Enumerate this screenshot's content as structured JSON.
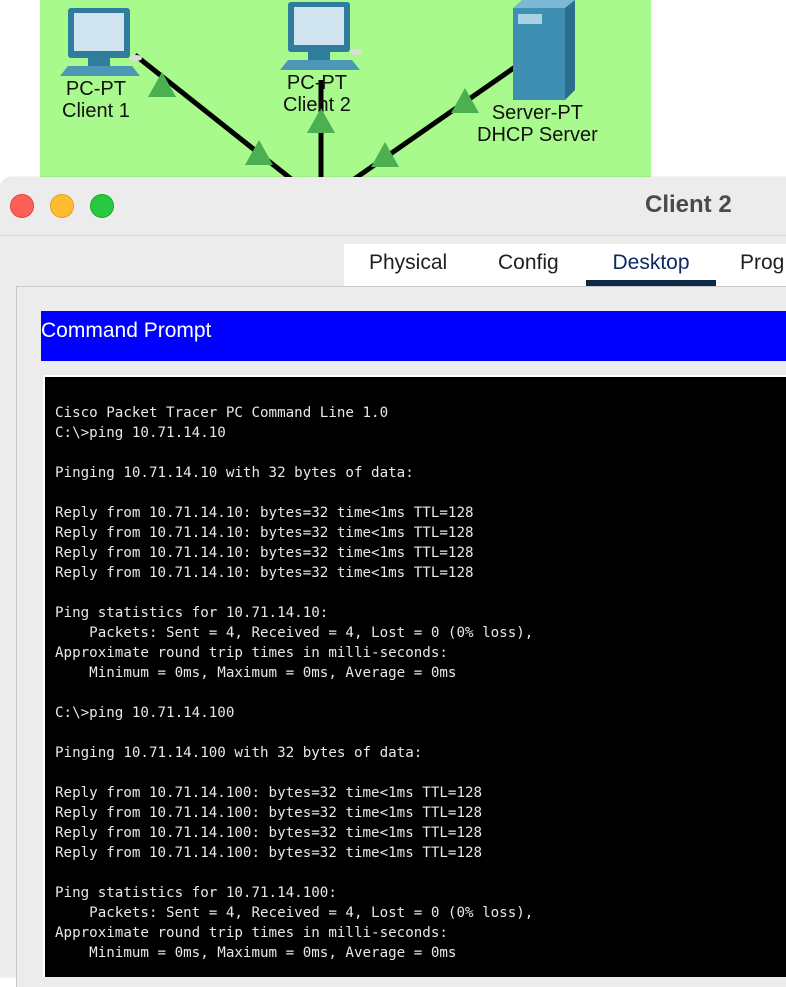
{
  "topology": {
    "background": "#a8fa8c",
    "devices": [
      {
        "type": "PC-PT",
        "name": "Client 1"
      },
      {
        "type": "PC-PT",
        "name": "Client 2"
      },
      {
        "type": "Server-PT",
        "name": "DHCP Server"
      }
    ]
  },
  "window": {
    "title": "Client 2",
    "tabs": [
      "Physical",
      "Config",
      "Desktop",
      "Prog"
    ],
    "active_tab": "Desktop"
  },
  "command_prompt": {
    "header": "Command Prompt",
    "lines": [
      "Cisco Packet Tracer PC Command Line 1.0",
      "C:\\>ping 10.71.14.10",
      "",
      "Pinging 10.71.14.10 with 32 bytes of data:",
      "",
      "Reply from 10.71.14.10: bytes=32 time<1ms TTL=128",
      "Reply from 10.71.14.10: bytes=32 time<1ms TTL=128",
      "Reply from 10.71.14.10: bytes=32 time<1ms TTL=128",
      "Reply from 10.71.14.10: bytes=32 time<1ms TTL=128",
      "",
      "Ping statistics for 10.71.14.10:",
      "    Packets: Sent = 4, Received = 4, Lost = 0 (0% loss),",
      "Approximate round trip times in milli-seconds:",
      "    Minimum = 0ms, Maximum = 0ms, Average = 0ms",
      "",
      "C:\\>ping 10.71.14.100",
      "",
      "Pinging 10.71.14.100 with 32 bytes of data:",
      "",
      "Reply from 10.71.14.100: bytes=32 time<1ms TTL=128",
      "Reply from 10.71.14.100: bytes=32 time<1ms TTL=128",
      "Reply from 10.71.14.100: bytes=32 time<1ms TTL=128",
      "Reply from 10.71.14.100: bytes=32 time<1ms TTL=128",
      "",
      "Ping statistics for 10.71.14.100:",
      "    Packets: Sent = 4, Received = 4, Lost = 0 (0% loss),",
      "Approximate round trip times in milli-seconds:",
      "    Minimum = 0ms, Maximum = 0ms, Average = 0ms"
    ]
  },
  "colors": {
    "header_blue": "#0000ff",
    "terminal_bg": "#000000",
    "active_tab_underline": "#0c2a48",
    "link_up": "#4caf50"
  }
}
